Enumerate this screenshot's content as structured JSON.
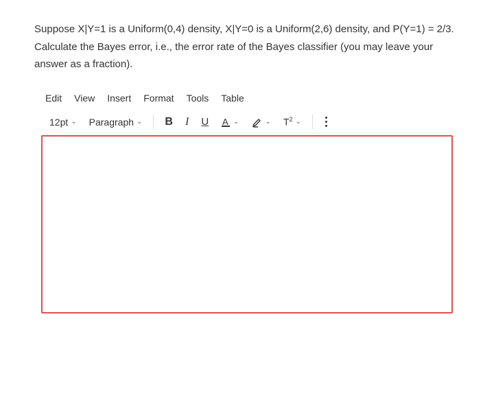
{
  "question": "Suppose X|Y=1 is a Uniform(0,4) density, X|Y=0 is a Uniform(2,6) density, and P(Y=1) = 2/3. Calculate the Bayes error, i.e., the error rate of the Bayes classifier (you may leave your answer as a fraction).",
  "menubar": {
    "edit": "Edit",
    "view": "View",
    "insert": "Insert",
    "format": "Format",
    "tools": "Tools",
    "table": "Table"
  },
  "toolbar": {
    "fontsize": "12pt",
    "paragraph": "Paragraph",
    "bold": "B",
    "italic": "I",
    "underline": "U",
    "textcolor": "A",
    "supersub": "T²"
  }
}
